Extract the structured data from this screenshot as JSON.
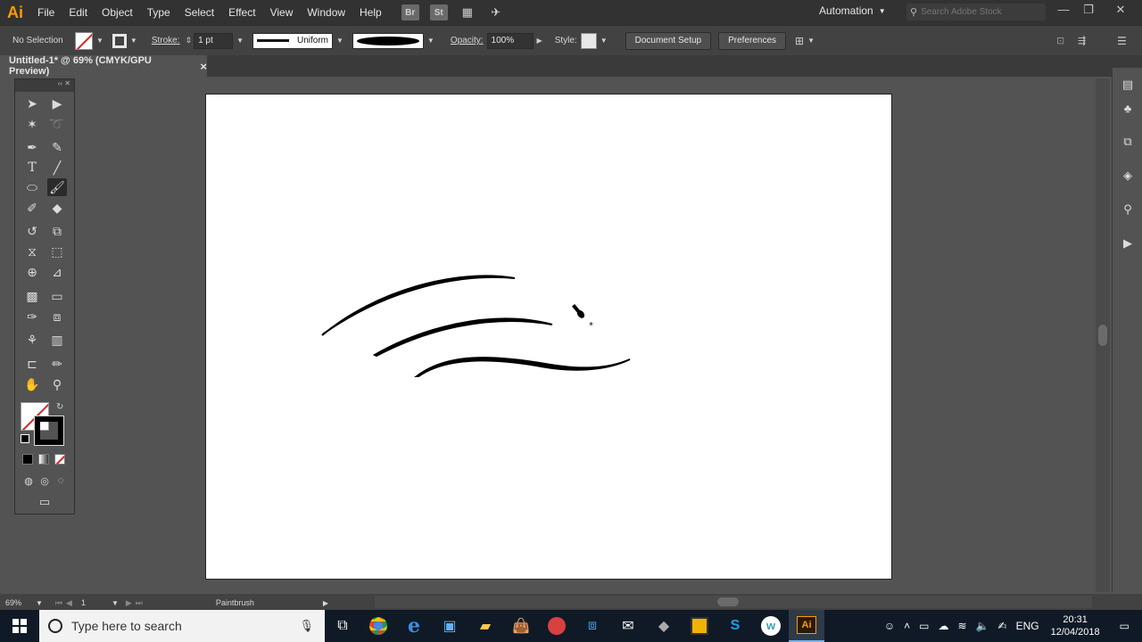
{
  "app": {
    "logo": "Ai",
    "menu": [
      "File",
      "Edit",
      "Object",
      "Type",
      "Select",
      "Effect",
      "View",
      "Window",
      "Help"
    ],
    "bridge_label": "Br",
    "stock_label": "St",
    "workspace": "Automation",
    "search_placeholder": "Search Adobe Stock"
  },
  "control": {
    "selection": "No Selection",
    "stroke_label": "Stroke:",
    "stroke_weight": "1 pt",
    "profile": "Uniform",
    "opacity_label": "Opacity:",
    "opacity": "100%",
    "style_label": "Style:",
    "document_setup": "Document Setup",
    "preferences": "Preferences"
  },
  "document": {
    "tab_title": "Untitled-1* @ 69% (CMYK/GPU Preview)",
    "close": "×"
  },
  "status": {
    "zoom": "69%",
    "artboard": "1",
    "tool": "Paintbrush"
  },
  "taskbar": {
    "search_placeholder": "Type here to search",
    "lang": "ENG",
    "time": "20:31",
    "date": "12/04/2018",
    "ai_label": "Ai"
  },
  "colors": {
    "accent": "#ff9a00",
    "ui_dark": "#323232",
    "ui_panel": "#535353",
    "stroke": "#000000"
  }
}
